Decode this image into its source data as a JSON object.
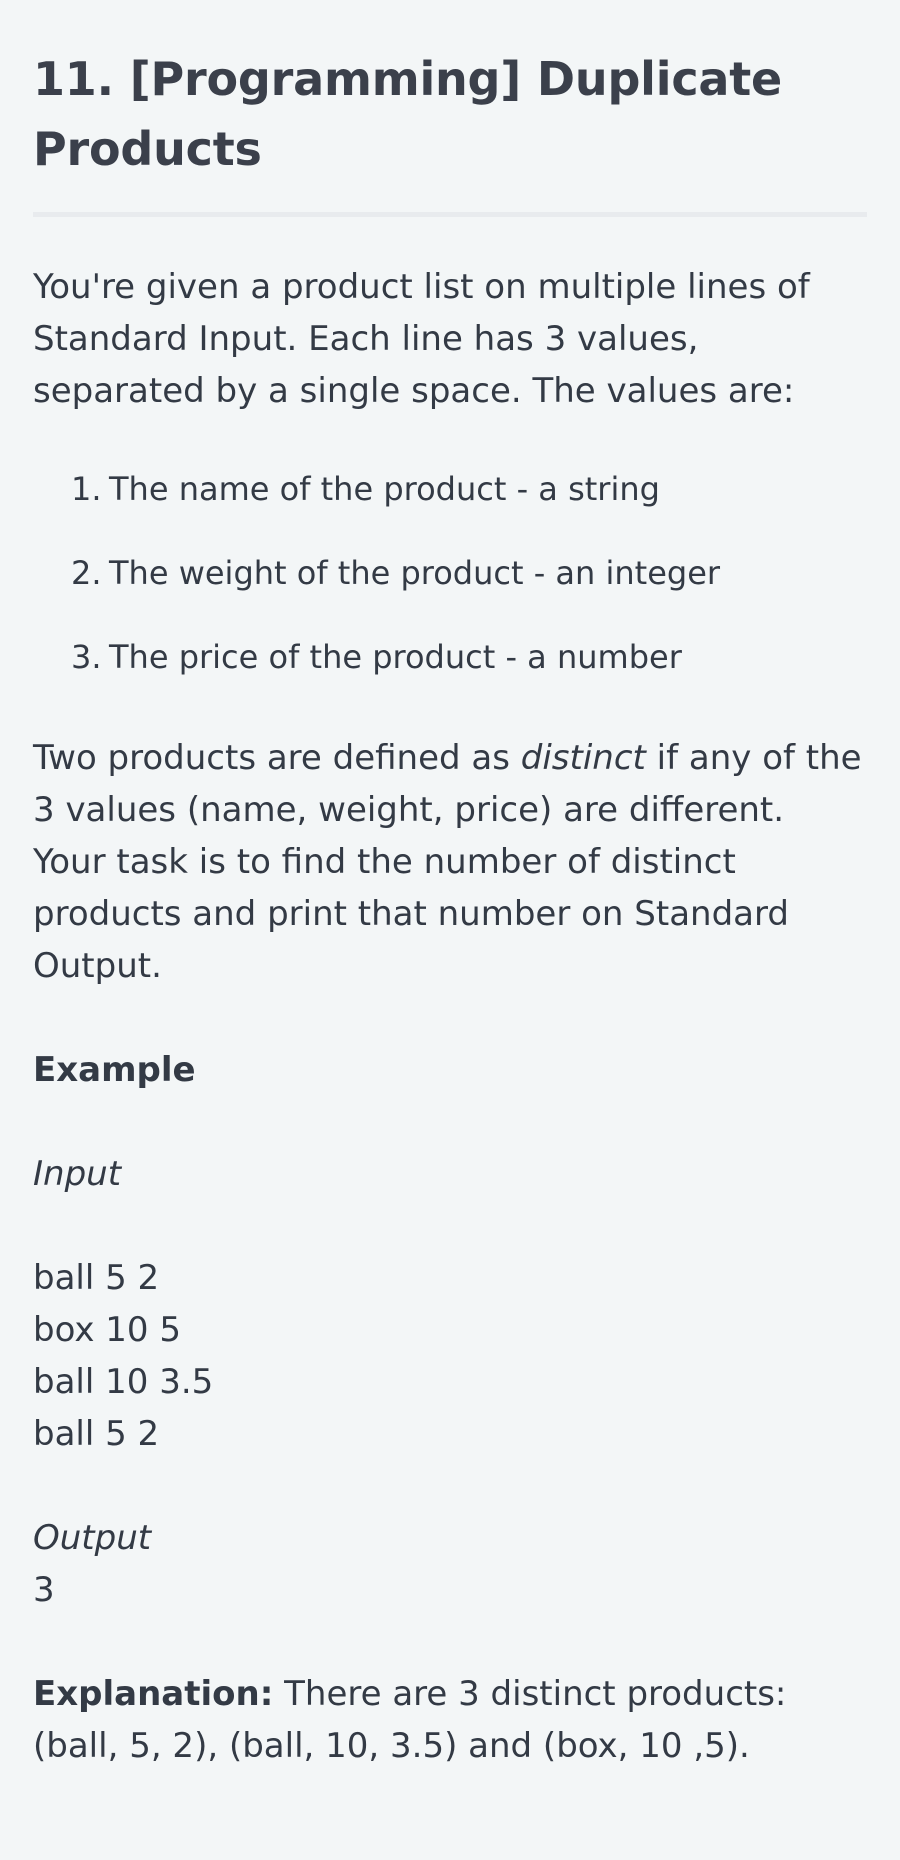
{
  "title": "11. [Programming] Duplicate Products",
  "intro": "You're given a product list on multiple lines of Standard Input. Each line has 3 values, separated by a single space. The values are:",
  "list": [
    {
      "num": "1.",
      "text": "The name of the product - a string"
    },
    {
      "num": "2.",
      "text": "The weight of the product - an integer"
    },
    {
      "num": "3.",
      "text": "The price of the product - a number"
    }
  ],
  "p2": {
    "before": "Two products are defined as ",
    "emphasis": "distinct",
    "after": " if any of the 3 values (name, weight, price) are different. Your task is to find the number of distinct products and print that number on Standard Output."
  },
  "example_heading": "Example",
  "input_label": "Input",
  "input_lines": [
    "ball 5 2",
    "box 10 5",
    "ball 10 3.5",
    "ball 5 2"
  ],
  "output_label": "Output",
  "output_value": "3",
  "explanation": {
    "label": "Explanation:",
    "text": " There are 3 distinct products: (ball, 5, 2), (ball, 10, 3.5) and (box, 10 ,5)."
  }
}
